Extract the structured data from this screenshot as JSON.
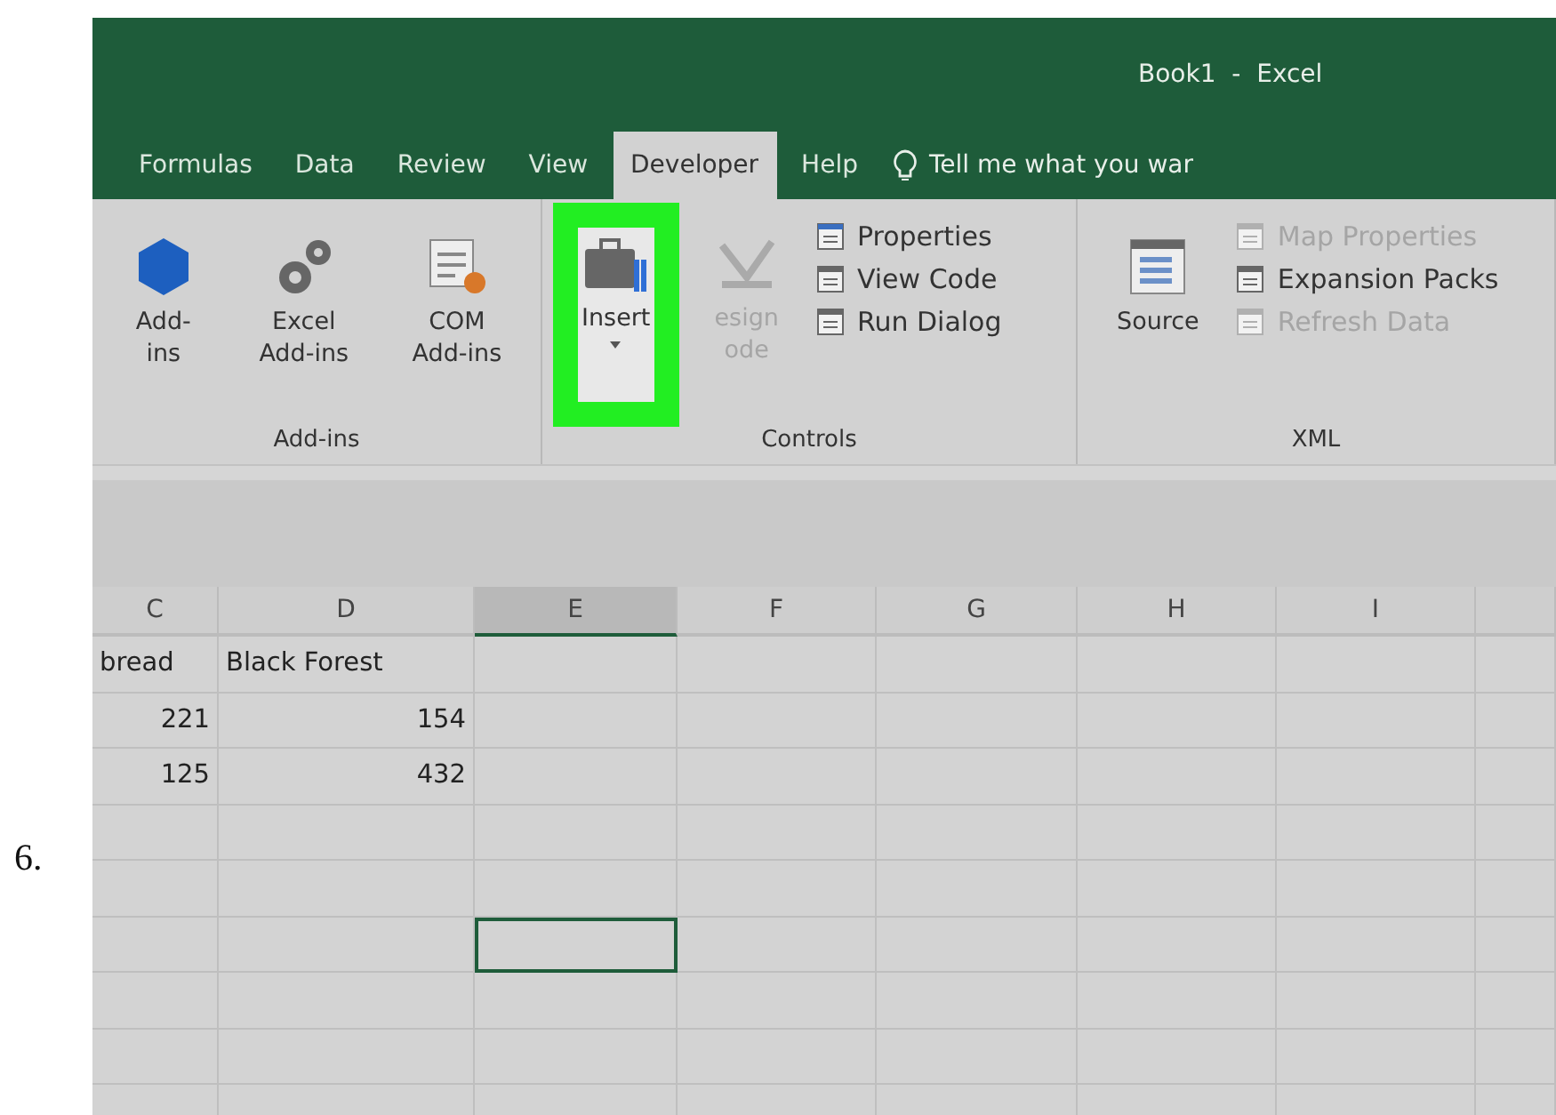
{
  "step": {
    "number": "6."
  },
  "window": {
    "title": "Book1  -  Excel"
  },
  "tabs": [
    {
      "label": "Formulas",
      "selected": false
    },
    {
      "label": "Data",
      "selected": false
    },
    {
      "label": "Review",
      "selected": false
    },
    {
      "label": "View",
      "selected": false
    },
    {
      "label": "Developer",
      "selected": true
    },
    {
      "label": "Help",
      "selected": false
    }
  ],
  "tell_me": {
    "placeholder": "Tell me what you war"
  },
  "ribbon": {
    "groups": [
      {
        "label": "Add-ins",
        "items": [
          {
            "kind": "large",
            "lines": [
              "Add-",
              "ins"
            ],
            "disabled": false,
            "highlighted": false
          },
          {
            "kind": "large",
            "lines": [
              "Excel",
              "Add-ins"
            ],
            "disabled": false,
            "highlighted": false
          },
          {
            "kind": "large",
            "lines": [
              "COM",
              "Add-ins"
            ],
            "disabled": false,
            "highlighted": false
          }
        ]
      },
      {
        "label": "Controls",
        "items": [
          {
            "kind": "large",
            "lines": [
              "Insert"
            ],
            "dropdown": true,
            "disabled": false,
            "highlighted": true
          },
          {
            "kind": "large",
            "lines": [
              "esign",
              "ode"
            ],
            "disabled": true,
            "highlighted": false
          },
          {
            "kind": "stack",
            "entries": [
              {
                "label": "Properties",
                "disabled": false
              },
              {
                "label": "View Code",
                "disabled": false
              },
              {
                "label": "Run Dialog",
                "disabled": false
              }
            ]
          }
        ]
      },
      {
        "label": "XML",
        "items": [
          {
            "kind": "large",
            "lines": [
              "Source"
            ],
            "disabled": false,
            "highlighted": false
          },
          {
            "kind": "stack",
            "entries": [
              {
                "label": "Map Properties",
                "disabled": true
              },
              {
                "label": "Expansion Packs",
                "disabled": false
              },
              {
                "label": "Refresh Data",
                "disabled": true
              }
            ]
          }
        ]
      }
    ]
  },
  "sheet": {
    "columns": [
      {
        "label": "C",
        "selected": false
      },
      {
        "label": "D",
        "selected": false
      },
      {
        "label": "E",
        "selected": true
      },
      {
        "label": "F",
        "selected": false
      },
      {
        "label": "G",
        "selected": false
      },
      {
        "label": "H",
        "selected": false
      },
      {
        "label": "I",
        "selected": false
      }
    ],
    "rows": [
      {
        "selected": false,
        "cells": [
          {
            "text": "bread",
            "kind": "text"
          },
          {
            "text": "Black Forest",
            "kind": "text"
          }
        ]
      },
      {
        "selected": false,
        "cells": [
          {
            "text": "221",
            "kind": "number"
          },
          {
            "text": "154",
            "kind": "number"
          }
        ]
      },
      {
        "selected": false,
        "cells": [
          {
            "text": "125",
            "kind": "number"
          },
          {
            "text": "432",
            "kind": "number"
          }
        ]
      },
      {
        "selected": false
      },
      {
        "selected": false
      },
      {
        "selected": true
      },
      {
        "selected": false
      },
      {
        "selected": false
      },
      {
        "selected": false
      }
    ]
  }
}
